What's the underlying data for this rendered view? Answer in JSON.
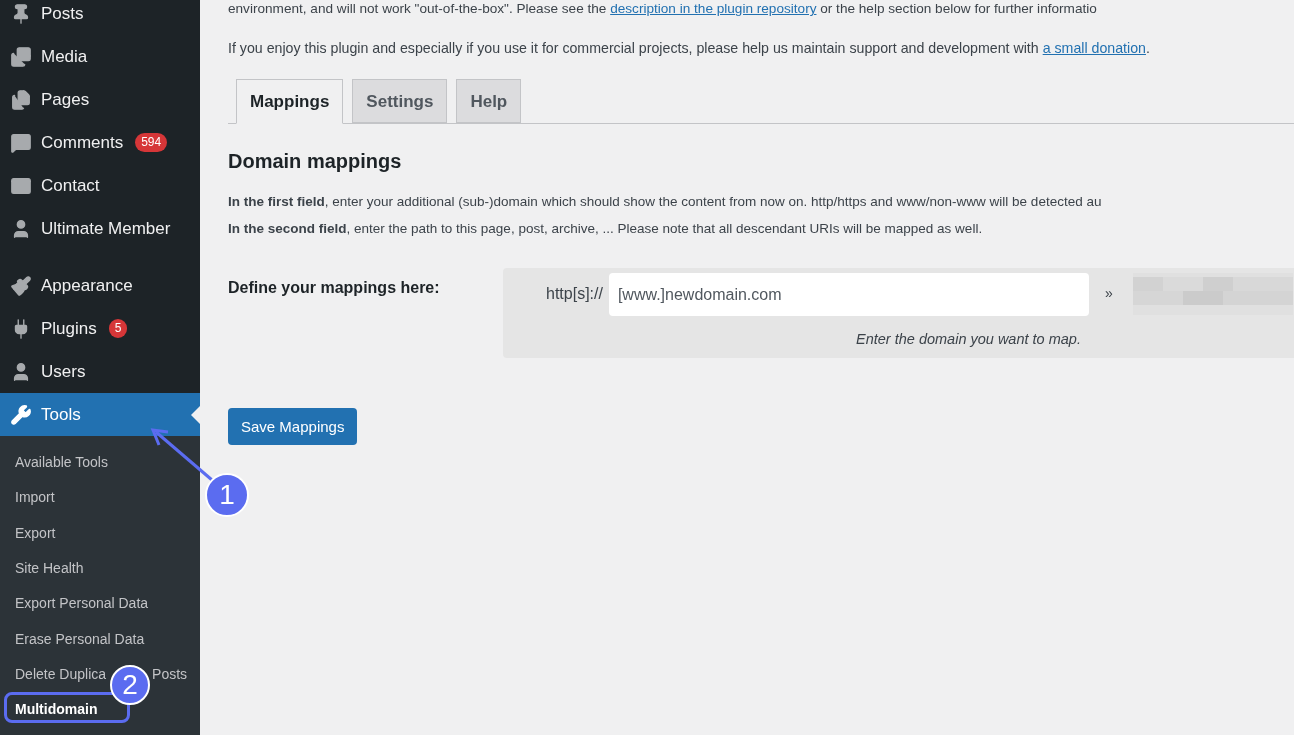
{
  "sidebar": {
    "groups": [
      {
        "items": [
          {
            "label": "Posts",
            "selected": false
          },
          {
            "label": "Media",
            "selected": false
          },
          {
            "label": "Pages",
            "selected": false
          },
          {
            "label": "Comments",
            "selected": false,
            "badge": "594"
          },
          {
            "label": "Contact",
            "selected": false
          },
          {
            "label": "Ultimate Member",
            "selected": false
          }
        ]
      },
      {
        "items": [
          {
            "label": "Appearance",
            "selected": false
          },
          {
            "label": "Plugins",
            "selected": false,
            "badge": "5"
          },
          {
            "label": "Users",
            "selected": false
          },
          {
            "label": "Tools",
            "selected": true
          }
        ]
      }
    ],
    "submenu": [
      {
        "label": "Available Tools",
        "selected": false
      },
      {
        "label": "Import",
        "selected": false
      },
      {
        "label": "Export",
        "selected": false
      },
      {
        "label": "Site Health",
        "selected": false
      },
      {
        "label": "Export Personal Data",
        "selected": false
      },
      {
        "label": "Erase Personal Data",
        "selected": false
      },
      {
        "label": "Delete Duplica",
        "label_after_cover": "Posts",
        "selected": false
      },
      {
        "label": "Multidomain",
        "selected": true
      }
    ]
  },
  "intro": {
    "line_1_before": "environment, and will not work \"out-of-the-box\". Please see the ",
    "line_1_link": "description in the plugin repository",
    "line_1_after": " or the help section below for further informatio",
    "line_2_before": "If you enjoy this plugin and especially if you use it for commercial projects, please help us maintain support and development with ",
    "line_2_link": "a small donation",
    "line_2_after": "."
  },
  "tabs": [
    {
      "label": "Mappings",
      "selected": true
    },
    {
      "label": "Settings",
      "selected": false
    },
    {
      "label": "Help",
      "selected": false
    }
  ],
  "section": {
    "title": "Domain mappings",
    "lines": [
      "**In the first field**, enter your additional (sub-)domain which should show the content from now on. http/https and www/non-www will be detected au",
      "**In the second field**, enter the path to this page, post, archive, ... Please note that all descendant URIs will be mapped as well."
    ]
  },
  "form": {
    "label": "Define your mappings here:",
    "prefix": "http[s]://",
    "placeholder": "[www.]newdomain.com",
    "hint": "Enter the domain you want to map.",
    "separator": "»"
  },
  "save_button": "Save Mappings",
  "annotations": [
    {
      "label": "1"
    },
    {
      "label": "2"
    }
  ]
}
